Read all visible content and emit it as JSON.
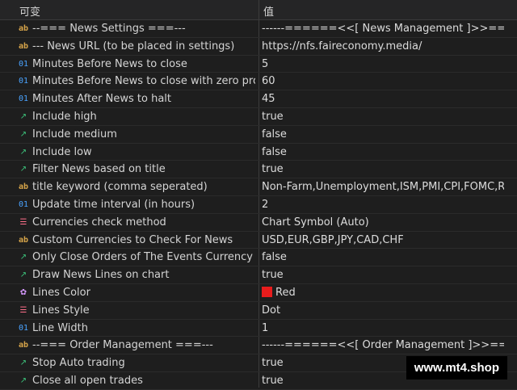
{
  "header": {
    "col_variable": "可变",
    "col_value": "值"
  },
  "rows": [
    {
      "icon": "ab-string-icon",
      "name": "--=== News Settings ===---",
      "value": "------======<<[  News Management  ]>>==..."
    },
    {
      "icon": "ab-string-icon",
      "name": "--- News URL (to be placed in settings)",
      "value": "https://nfs.faireconomy.media/"
    },
    {
      "icon": "01-integer-icon",
      "name": "Minutes Before News to close",
      "value": "5"
    },
    {
      "icon": "01-integer-icon",
      "name": "Minutes Before News to close with zero pro...",
      "value": "60"
    },
    {
      "icon": "01-integer-icon",
      "name": "Minutes After News to halt",
      "value": "45"
    },
    {
      "icon": "bool-arrow-icon",
      "name": "Include high",
      "value": "true"
    },
    {
      "icon": "bool-arrow-icon",
      "name": "Include medium",
      "value": "false"
    },
    {
      "icon": "bool-arrow-icon",
      "name": "Include low",
      "value": "false"
    },
    {
      "icon": "bool-arrow-icon",
      "name": "Filter News based on title",
      "value": "true"
    },
    {
      "icon": "ab-string-icon",
      "name": "title keyword (comma seperated)",
      "value": "Non-Farm,Unemployment,ISM,PMI,CPI,FOMC,R..."
    },
    {
      "icon": "01-integer-icon",
      "name": "Update time interval (in hours)",
      "value": "2"
    },
    {
      "icon": "enum-list-icon",
      "name": "Currencies check method",
      "value": "Chart Symbol (Auto)"
    },
    {
      "icon": "ab-string-icon",
      "name": "Custom Currencies to Check For News",
      "value": "USD,EUR,GBP,JPY,CAD,CHF"
    },
    {
      "icon": "bool-arrow-icon",
      "name": "Only Close Orders of The Events Currency",
      "value": "false"
    },
    {
      "icon": "bool-arrow-icon",
      "name": "Draw News Lines on chart",
      "value": "true"
    },
    {
      "icon": "color-palette-icon",
      "name": "Lines Color",
      "value": "Red",
      "swatch": "#e81c1c"
    },
    {
      "icon": "enum-list-icon",
      "name": "Lines Style",
      "value": "Dot"
    },
    {
      "icon": "01-integer-icon",
      "name": "Line Width",
      "value": "1"
    },
    {
      "icon": "ab-string-icon",
      "name": "--=== Order Management ===---",
      "value": "------======<<[  Order Management  ]>>==..."
    },
    {
      "icon": "bool-arrow-icon",
      "name": "Stop Auto trading",
      "value": "true"
    },
    {
      "icon": "bool-arrow-icon",
      "name": "Close all open trades",
      "value": "true"
    }
  ],
  "watermark": "www.mt4.shop"
}
